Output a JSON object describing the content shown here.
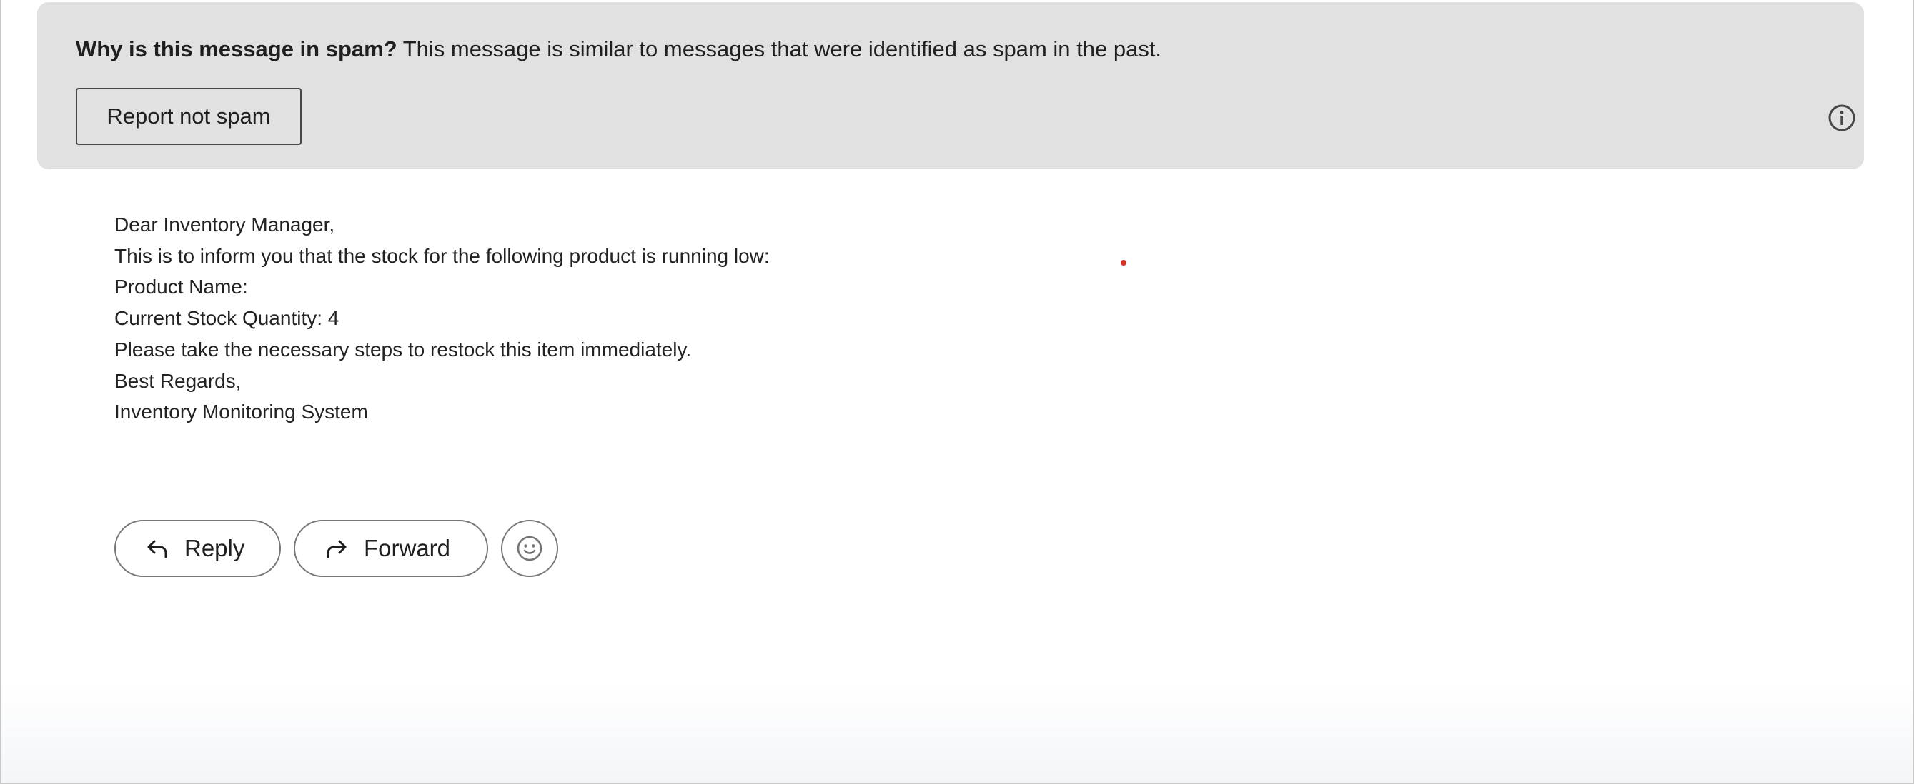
{
  "spam_banner": {
    "question": "Why is this message in spam?",
    "explanation": " This message is similar to messages that were identified as spam in the past.",
    "report_button": "Report not spam",
    "info_icon": "info-icon"
  },
  "message": {
    "lines": [
      "Dear Inventory Manager,",
      "This is to inform you that the stock for the following product is running low:",
      "Product Name:",
      "Current Stock Quantity: 4",
      "Please take the necessary steps to restock this item immediately.",
      "Best Regards,",
      "Inventory Monitoring System"
    ]
  },
  "actions": {
    "reply_label": "Reply",
    "reply_icon": "reply-arrow-icon",
    "forward_label": "Forward",
    "forward_icon": "forward-arrow-icon",
    "emoji_icon": "smiley-face-icon"
  },
  "colors": {
    "banner_bg": "#e1e1e1",
    "button_border": "#747775",
    "cursor_dot": "#d93025"
  }
}
